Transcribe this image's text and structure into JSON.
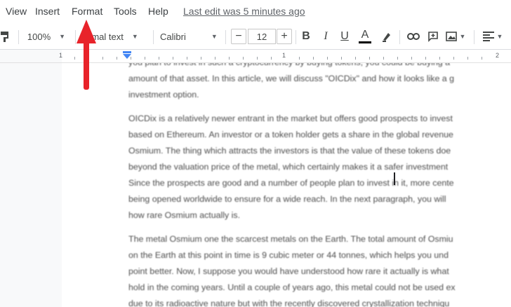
{
  "menu": {
    "items": [
      "View",
      "Insert",
      "Format",
      "Tools",
      "Help"
    ],
    "last_edit": "Last edit was 5 minutes ago"
  },
  "toolbar": {
    "zoom": "100%",
    "style": "rmal text",
    "font": "Calibri",
    "font_size": "12",
    "decrease": "−",
    "increase": "+",
    "bold": "B",
    "italic": "I",
    "underline": "U",
    "text_color": "A",
    "text_color_value": "#000000",
    "icons": [
      "paint-format-icon",
      "highlighter-icon",
      "link-icon",
      "comment-icon",
      "image-icon",
      "align-icon"
    ]
  },
  "ruler": {
    "marks": [
      "1",
      "1",
      "2"
    ]
  },
  "document": {
    "lines": [
      "you plan to invest in such a cryptocurrency by buying tokens, you could be buying a",
      "amount of that asset. In this article, we will discuss \"OICDix\" and how it looks like a g",
      "investment option.",
      "",
      "OICDix is a relatively newer entrant in the market but offers good prospects to invest",
      "based on Ethereum. An investor or a token holder gets a share in the global revenue",
      "Osmium. The thing which attracts the investors is that the value of these tokens doe",
      "beyond the valuation price of the metal, which certainly makes it a safer investment",
      "Since the prospects are good and a number of people plan to invest in it, more cente",
      "being opened worldwide to ensure for a wide reach. In the next paragraph, you will",
      "how rare Osmium actually is.",
      "",
      "The metal Osmium one the scarcest metals on the Earth. The total amount of Osmiu",
      "on the Earth at this point in time is 9 cubic meter or 44 tonnes, which helps you und",
      "point better. Now, I suppose you would have understood how rare it actually is what",
      "hold in the coming years. Until a couple of years ago, this metal could not be used ex",
      "due to its radioactive nature but with the recently discovered crystallization techniqu"
    ]
  },
  "colors": {
    "accent_arrow": "#e8232a",
    "link_underline": "#4a6fdc",
    "spell_error": "#d93025"
  }
}
